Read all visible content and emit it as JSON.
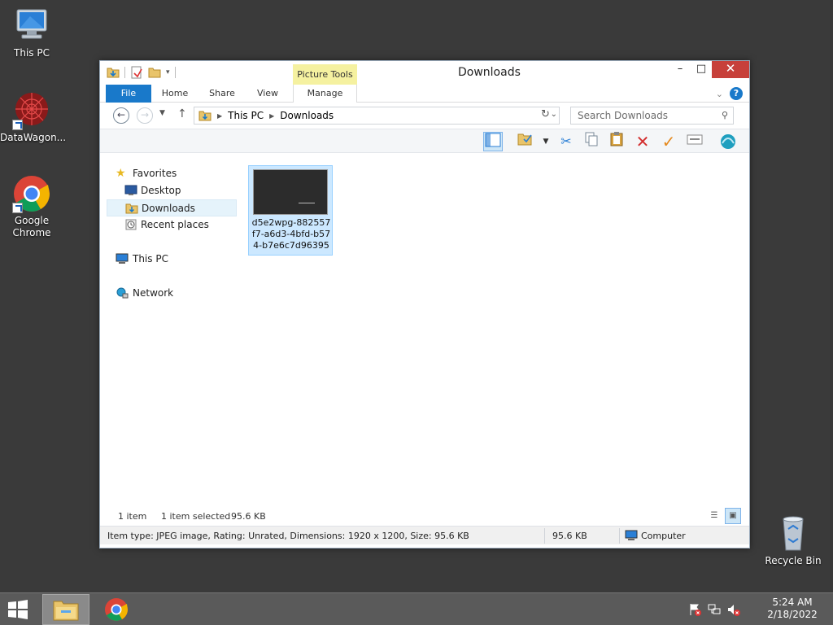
{
  "desktop": {
    "icons": [
      {
        "label": "This PC"
      },
      {
        "label": "DataWagon..."
      },
      {
        "label": "Google Chrome"
      },
      {
        "label": "Recycle Bin"
      }
    ]
  },
  "window": {
    "title": "Downloads",
    "context_tab": "Picture Tools",
    "tabs": [
      "File",
      "Home",
      "Share",
      "View",
      "Manage"
    ],
    "controls": {
      "minimize": "–",
      "maximize": "□",
      "close": "✕"
    },
    "help": "?",
    "address": {
      "crumbs": [
        "This PC",
        "Downloads"
      ]
    },
    "search": {
      "placeholder": "Search Downloads"
    },
    "nav": {
      "favorites": "Favorites",
      "desktop": "Desktop",
      "downloads": "Downloads",
      "recent": "Recent places",
      "this_pc": "This PC",
      "network": "Network"
    },
    "files": [
      {
        "name": "d5e2wpg-882557f7-a6d3-4bfd-b574-b7e6c7d96395",
        "selected": true
      }
    ],
    "status": {
      "item_count": "1 item",
      "selected": "1 item selected",
      "size": "95.6 KB"
    },
    "details": {
      "text": "Item type: JPEG image, Rating: Unrated, Dimensions: 1920 x 1200, Size: 95.6 KB",
      "size": "95.6 KB",
      "location": "Computer"
    }
  },
  "taskbar": {
    "time": "5:24 AM",
    "date": "2/18/2022"
  },
  "colors": {
    "accent": "#1979ca",
    "close": "#c7403a",
    "selection": "#cce8ff",
    "desktop": "#3a3a3a",
    "context_tab": "#f5f1a0"
  }
}
